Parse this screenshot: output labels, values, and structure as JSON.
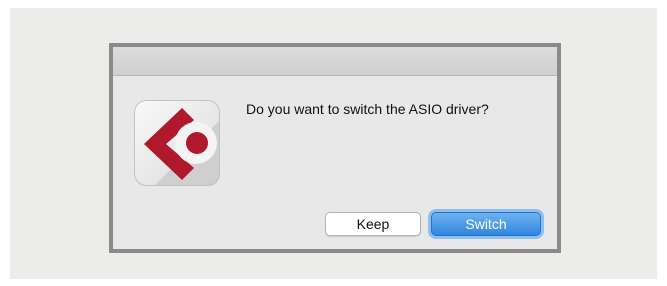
{
  "dialog": {
    "message": "Do you want to switch the ASIO driver?",
    "app_icon": "cubase-logo-icon",
    "buttons": {
      "keep_label": "Keep",
      "switch_label": "Switch"
    }
  },
  "colors": {
    "backdrop": "#ececea",
    "dialog_border": "#8a8a8a",
    "logo_red": "#b0182c",
    "default_button": "#2f86e0"
  }
}
